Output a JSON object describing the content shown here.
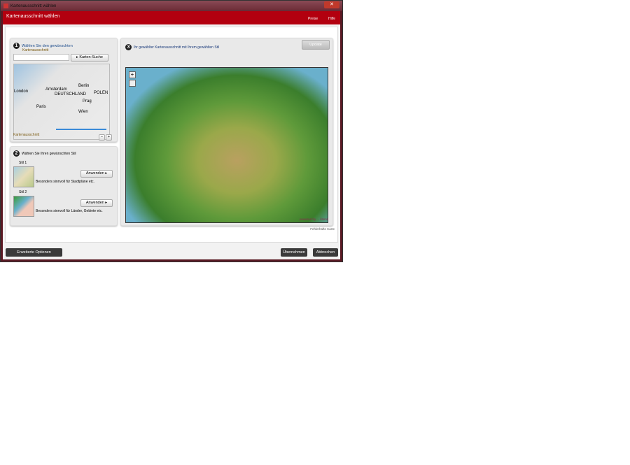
{
  "window": {
    "title": "Kartenausschnitt wählen",
    "close": "✕"
  },
  "header": {
    "title": "Kartenausschnitt wählen",
    "menu": [
      "Preise",
      "Hilfe"
    ]
  },
  "step1": {
    "num": "1",
    "title": "Wählen Sie den gewünschten",
    "subtitle": "Kartenausschnitt",
    "search_value": "",
    "search_button": "▸ Karten-Suche",
    "map_labels": [
      "London",
      "Amsterdam",
      "Berlin",
      "Paris",
      "Prag",
      "Wien",
      "POLEN",
      "DEUTSCHLAND"
    ],
    "footer": "Kartenausschnitt",
    "zoom_minus": "−",
    "zoom_plus": "+"
  },
  "step2": {
    "num": "2",
    "title": "Wählen Sie Ihren gewünschten Stil",
    "styles": [
      {
        "name": "Stil 1",
        "desc": "Besonders sinnvoll für Stadtpläne etc.",
        "button": "Anwenden ▸"
      },
      {
        "name": "Stil 2",
        "desc": "Besonders sinnvoll für Länder, Gebiete etc.",
        "button": "Anwenden ▸"
      }
    ]
  },
  "step3": {
    "num": "3",
    "title": "Ihr gewählter Kartenausschnitt mit Ihrem gewählten Stil",
    "update_button": "Update",
    "powered": "powered by ... lizenz",
    "note": "Fehlerhafte Karte"
  },
  "footer": {
    "advanced": "Erweiterte Optionen",
    "ok": "Übernehmen",
    "cancel": "Abbrechen"
  }
}
